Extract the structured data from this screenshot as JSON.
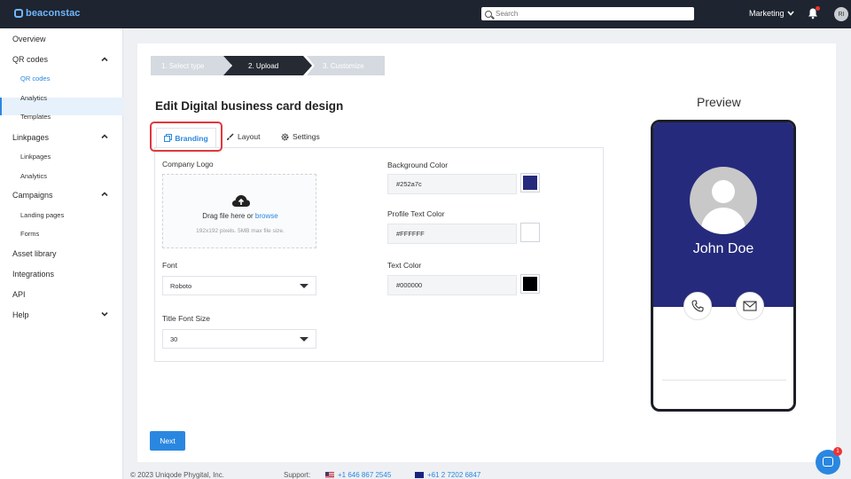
{
  "topbar": {
    "logo_text": "beaconstac",
    "search_placeholder": "Search",
    "org_name": "Marketing",
    "user_initials": "RI",
    "notification_count": "1"
  },
  "sidebar": {
    "overview": "Overview",
    "qr_codes": "QR codes",
    "qr_codes_sub": [
      "QR codes",
      "Analytics",
      "Templates"
    ],
    "linkpages": "Linkpages",
    "linkpages_sub": [
      "Linkpages",
      "Analytics"
    ],
    "campaigns": "Campaigns",
    "campaigns_sub": [
      "Landing pages",
      "Forms"
    ],
    "asset_library": "Asset library",
    "integrations": "Integrations",
    "api": "API",
    "help": "Help"
  },
  "stepper": {
    "step1": "1. Select type",
    "step2": "2. Upload",
    "step3": "3. Customize"
  },
  "page_title": "Edit Digital business card design",
  "tabs": {
    "branding": "Branding",
    "layout": "Layout",
    "settings": "Settings"
  },
  "form": {
    "company_logo_label": "Company Logo",
    "drag_text": "Drag file here or",
    "browse_link": "browse",
    "file_hint": "192x192 pixels. 5MB max file size.",
    "font_label": "Font",
    "font_value": "Roboto",
    "title_font_size_label": "Title Font Size",
    "title_font_size_value": "30",
    "background_color_label": "Background Color",
    "background_color_value": "#252a7c",
    "profile_text_color_label": "Profile Text Color",
    "profile_text_color_value": "#FFFFFF",
    "text_color_label": "Text Color",
    "text_color_value": "#000000"
  },
  "next_button": "Next",
  "preview": {
    "title": "Preview",
    "name": "John Doe"
  },
  "footer": {
    "copyright": "© 2023 Uniqode Phygital, Inc.",
    "support_label": "Support:",
    "phone_us": "+1 646 867 2545",
    "phone_au": "+61 2 7202 6847"
  },
  "colors": {
    "accent": "#2a87e0",
    "topbar": "#1e2430",
    "card_bg": "#252a7c",
    "highlight": "#e0383e"
  }
}
